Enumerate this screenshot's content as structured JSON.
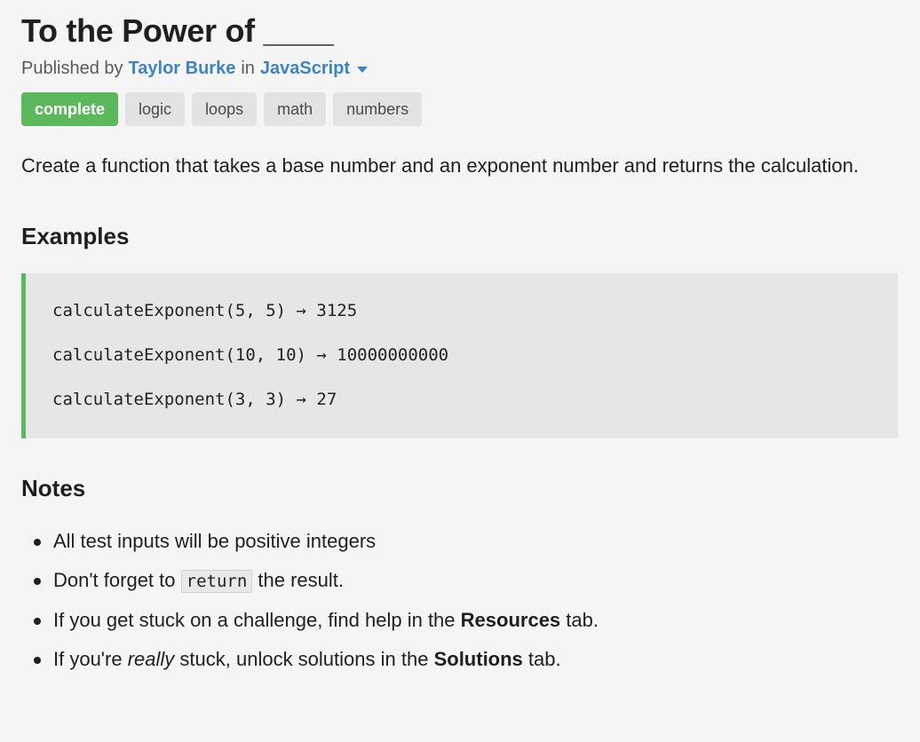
{
  "challenge": {
    "title": "To the Power of ____",
    "published_by_label": "Published by",
    "author": "Taylor Burke",
    "in_label": "in",
    "language": "JavaScript"
  },
  "tags": {
    "status": "complete",
    "items": [
      "logic",
      "loops",
      "math",
      "numbers"
    ]
  },
  "description": "Create a function that takes a base number and an exponent number and returns the calculation.",
  "examples": {
    "heading": "Examples",
    "lines": [
      "calculateExponent(5, 5) → 3125",
      "calculateExponent(10, 10) → 10000000000",
      "calculateExponent(3, 3) → 27"
    ]
  },
  "notes": {
    "heading": "Notes",
    "note1": "All test inputs will be positive integers",
    "note2": {
      "before": "Don't forget to",
      "code": "return",
      "after": "the result."
    },
    "note3": {
      "before": "If you get stuck on a challenge, find help in the",
      "bold": "Resources",
      "after": "tab."
    },
    "note4": {
      "before": "If you're",
      "italic": "really",
      "middle": "stuck, unlock solutions in the",
      "bold": "Solutions",
      "after": "tab."
    }
  },
  "colors": {
    "link": "#3c84c5",
    "status_green": "#5cb85c",
    "tag_gray": "#e3e3e3",
    "code_bg": "#e6e6e6",
    "page_bg": "#f5f5f5"
  },
  "icons": {
    "language_dropdown": "caret-down-icon"
  }
}
